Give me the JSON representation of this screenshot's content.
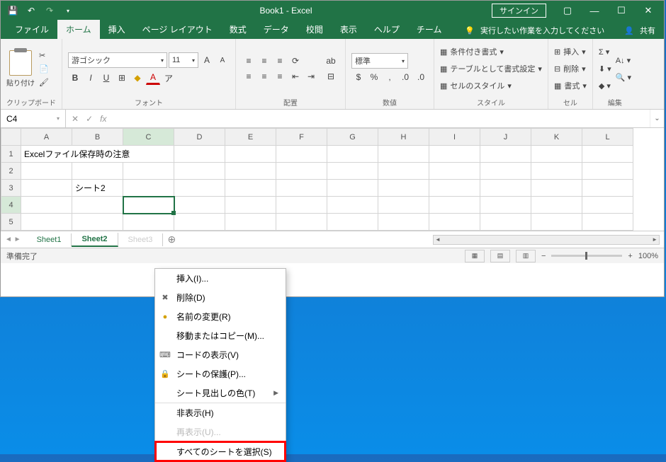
{
  "title": "Book1 - Excel",
  "signin": "サインイン",
  "tabs": {
    "file": "ファイル",
    "home": "ホーム",
    "insert": "挿入",
    "pagelayout": "ページ レイアウト",
    "formulas": "数式",
    "data": "データ",
    "review": "校閲",
    "view": "表示",
    "help": "ヘルプ",
    "team": "チーム"
  },
  "tabs_right": {
    "tellme": "実行したい作業を入力してください",
    "share": "共有"
  },
  "ribbon": {
    "clipboard": "クリップボード",
    "paste": "貼り付け",
    "font": "フォント",
    "fontname": "游ゴシック",
    "fontsize": "11",
    "align": "配置",
    "number": "数値",
    "numfmt": "標準",
    "styles": "スタイル",
    "cond": "条件付き書式",
    "tablefmt": "テーブルとして書式設定",
    "cellstyle": "セルのスタイル",
    "cells": "セル",
    "ins": "挿入",
    "del": "削除",
    "fmt": "書式",
    "editing": "編集"
  },
  "namebox": "C4",
  "cells": {
    "A1": "Excelファイル保存時の注意",
    "B3": "シート2"
  },
  "cols": [
    "A",
    "B",
    "C",
    "D",
    "E",
    "F",
    "G",
    "H",
    "I",
    "J",
    "K",
    "L"
  ],
  "rows": [
    "1",
    "2",
    "3",
    "4",
    "5"
  ],
  "sheets": {
    "s1": "Sheet1",
    "s2": "Sheet2",
    "s3": "Sheet3"
  },
  "status": "準備完了",
  "zoom": "100%",
  "ctx": {
    "insert": "挿入(I)...",
    "delete": "削除(D)",
    "rename": "名前の変更(R)",
    "move": "移動またはコピー(M)...",
    "viewcode": "コードの表示(V)",
    "protect": "シートの保護(P)...",
    "tabcolor": "シート見出しの色(T)",
    "hide": "非表示(H)",
    "unhide": "再表示(U)...",
    "selectall": "すべてのシートを選択(S)"
  }
}
